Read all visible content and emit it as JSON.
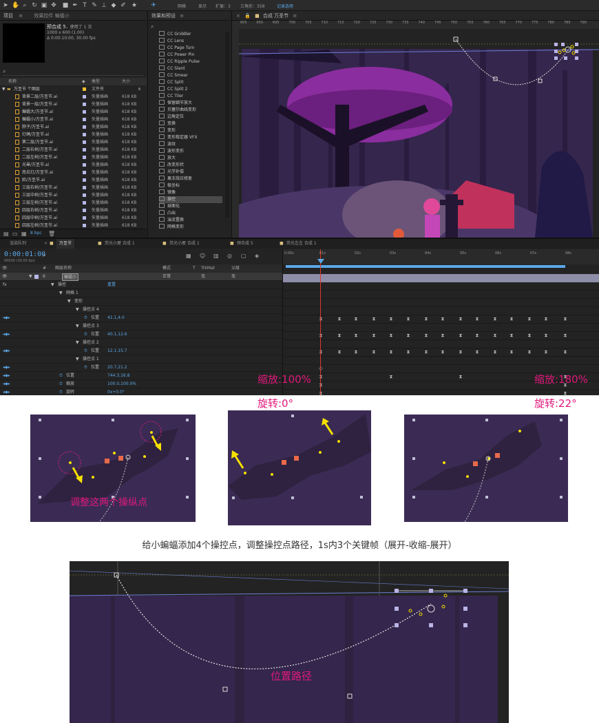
{
  "toolbar": {
    "items": [
      "网格",
      "显示",
      "扩展：3",
      "三角形：358",
      "记录选项"
    ]
  },
  "project_panel": {
    "title": "项目",
    "fx_controls_title": "效果控件 蝙蝠小",
    "comp_name": "预合成 5",
    "usage": "，使用了 1 次",
    "dims": "1000 x 600 (1.00)",
    "duration": "Δ 0:00:10:00, 30.00 fps",
    "col_name": "名称",
    "col_type": "类型",
    "col_size": "大小",
    "footer_bpc": "8 bpc",
    "rows": [
      {
        "name": "万圣节 个图层",
        "type": "文件夹",
        "size": ""
      },
      {
        "name": "背景二层/万圣节.ai",
        "type": "矢量插画",
        "size": "618 KB"
      },
      {
        "name": "背景一层/万圣节.ai",
        "type": "矢量插画",
        "size": "618 KB"
      },
      {
        "name": "蝙蝠大/万圣节.ai",
        "type": "矢量插画",
        "size": "618 KB"
      },
      {
        "name": "蝙蝠小/万圣节.ai",
        "type": "矢量插画",
        "size": "618 KB"
      },
      {
        "name": "脖子/万圣节.ai",
        "type": "矢量插画",
        "size": "618 KB"
      },
      {
        "name": "灯绳/万圣节.ai",
        "type": "矢量插画",
        "size": "618 KB"
      },
      {
        "name": "第二层/万圣节.ai",
        "type": "矢量插画",
        "size": "618 KB"
      },
      {
        "name": "二层右树/万圣节.ai",
        "type": "矢量插画",
        "size": "618 KB"
      },
      {
        "name": "二层左树/万圣节.ai",
        "type": "矢量插画",
        "size": "618 KB"
      },
      {
        "name": "光晕/万圣节.ai",
        "type": "矢量插画",
        "size": "618 KB"
      },
      {
        "name": "南瓜灯/万圣节.ai",
        "type": "矢量插画",
        "size": "618 KB"
      },
      {
        "name": "脸/万圣节.ai",
        "type": "矢量插画",
        "size": "618 KB"
      },
      {
        "name": "三层右树/万圣节.ai",
        "type": "矢量插画",
        "size": "618 KB"
      },
      {
        "name": "三层中树/万圣节.ai",
        "type": "矢量插画",
        "size": "618 KB"
      },
      {
        "name": "三层左树/万圣节.ai",
        "type": "矢量插画",
        "size": "618 KB"
      },
      {
        "name": "四层右树/万圣节.ai",
        "type": "矢量插画",
        "size": "618 KB"
      },
      {
        "name": "四层中树/万圣节.ai",
        "type": "矢量插画",
        "size": "618 KB"
      },
      {
        "name": "四层左树/万圣节.ai",
        "type": "矢量插画",
        "size": "618 KB"
      }
    ]
  },
  "effects_panel": {
    "title": "效果和预设",
    "items": [
      "CC Griddler",
      "CC Lens",
      "CC Page Turn",
      "CC Power Pin",
      "CC Ripple Pulse",
      "CC Slant",
      "CC Smear",
      "CC Split",
      "CC Split 2",
      "CC Tiler",
      "保留细节放大",
      "贝塞尔曲线变形",
      "边角定位",
      "变换",
      "变形",
      "变形稳定器 VFX",
      "波纹",
      "波形变形",
      "放大",
      "改变形状",
      "光学补偿",
      "果冻效应修复",
      "极坐标",
      "镜像",
      "操控",
      "球面化",
      "凸出",
      "湍流置换",
      "网格变形"
    ],
    "selected": "操控"
  },
  "viewer": {
    "title": "合成 万圣节",
    "ruler_ticks": [
      "605",
      "650",
      "695",
      "700",
      "705",
      "710",
      "715",
      "720",
      "725",
      "730",
      "735",
      "740",
      "745",
      "750",
      "755",
      "760",
      "765",
      "770",
      "775",
      "780",
      "785",
      "790"
    ]
  },
  "timeline": {
    "tabs": [
      "渲染队列",
      "万圣节",
      "荧光小屋 合成 1",
      "荧光小屋 合成 1",
      "预合成 5",
      "荧光左左 合成 1"
    ],
    "timecode": "0:00:01:00",
    "timecode_sub": "00030 (30.00 fps)",
    "search_placeholder": "",
    "columns": {
      "index": "#",
      "layer_name": "图层名称",
      "mode": "模式",
      "t": "T",
      "trkmat": "TrkMat",
      "parent": "父级"
    },
    "layer": {
      "index": "6",
      "name": "蝙蝠小",
      "mode": "正常",
      "trkmat": "无",
      "parent": "无"
    },
    "ruler": [
      "0:00s",
      "01s",
      "02s",
      "03s",
      "04s",
      "05s",
      "06s",
      "07s",
      "08s"
    ],
    "props": [
      {
        "indent": 1,
        "label": "操控",
        "value": "重置"
      },
      {
        "indent": 2,
        "label": "网格 1",
        "value": ""
      },
      {
        "indent": 3,
        "label": "变形",
        "value": ""
      },
      {
        "indent": 4,
        "label": "操控点 4",
        "value": ""
      },
      {
        "indent": 5,
        "label": "位置",
        "value": "41.1,4.0"
      },
      {
        "indent": 4,
        "label": "操控点 3",
        "value": ""
      },
      {
        "indent": 5,
        "label": "位置",
        "value": "40.1,12.6"
      },
      {
        "indent": 4,
        "label": "操控点 2",
        "value": ""
      },
      {
        "indent": 5,
        "label": "位置",
        "value": "12.1,15.7"
      },
      {
        "indent": 4,
        "label": "操控点 1",
        "value": ""
      },
      {
        "indent": 5,
        "label": "位置",
        "value": "20.7,21.2"
      },
      {
        "indent": 2,
        "label": "位置",
        "value": "744.3,16.8"
      },
      {
        "indent": 2,
        "label": "缩放",
        "value": "100.0,100.0%"
      },
      {
        "indent": 2,
        "label": "旋转",
        "value": "0x+0.0°"
      }
    ]
  },
  "annotations": {
    "scale_start": "缩放:100%",
    "rotate_start": "旋转:0°",
    "scale_end": "缩放:180%",
    "rotate_end": "旋转:22°",
    "adjust_label": "调整这两个操纵点",
    "caption": "给小蝙蝠添加4个操控点，调整操控点路径，1s内3个关键帧（展开-收缩-展开）",
    "path_label": "位置路径"
  },
  "colors": {
    "accent_pink": "#e0197b",
    "timecode_blue": "#5aa8e8",
    "scene_purple": "#3b2b54",
    "pin_yellow": "#f5e000"
  }
}
